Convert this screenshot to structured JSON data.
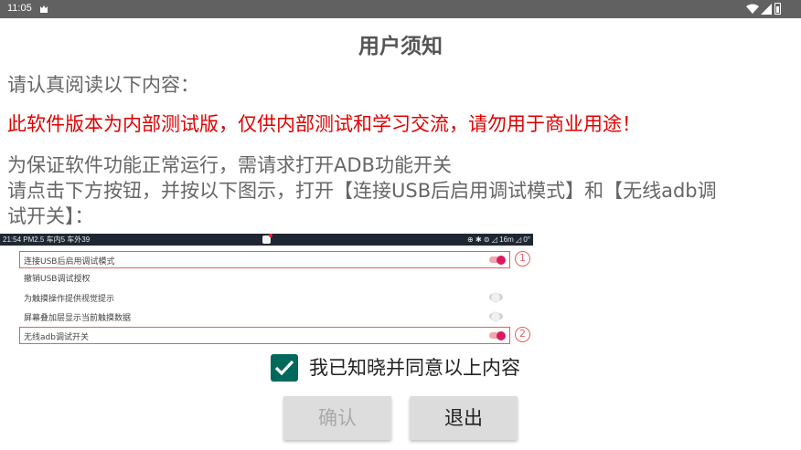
{
  "status_bar": {
    "time": "11:05"
  },
  "dialog": {
    "title": "用户须知",
    "read_prompt": "请认真阅读以下内容：",
    "warning": "此软件版本为内部测试版，仅供内部测试和学习交流，请勿用于商业用途！",
    "instructions": [
      "为保证软件功能正常运行，需请求打开ADB功能开关",
      "请点击下方按钮，并按以下图示，打开【连接USB后启用调试模式】和【无线adb调",
      "试开关】："
    ]
  },
  "guide_image": {
    "status_left": "21:54 PM2.5 车内5 车外39",
    "status_right": "⊕ ✱ ⊜ ◿ 16m ◿ 0°",
    "rows": [
      {
        "label": "连接USB后启用调试模式",
        "toggle": "on",
        "marker": "1"
      },
      {
        "label": "撤销USB调试授权"
      },
      {
        "label": "为触摸操作提供视觉提示",
        "toggle": "off"
      },
      {
        "label": "屏幕叠加层显示当前触摸数据",
        "toggle": "off"
      },
      {
        "label": "无线adb调试开关",
        "toggle": "on",
        "marker": "2"
      }
    ]
  },
  "agree": {
    "checked": true,
    "label": "我已知晓并同意以上内容"
  },
  "buttons": {
    "confirm": "确认",
    "exit": "退出"
  },
  "colors": {
    "status_bar": "#616161",
    "warning": "#e00000",
    "checkbox": "#00695c",
    "accent_toggle": "#d81b60"
  }
}
